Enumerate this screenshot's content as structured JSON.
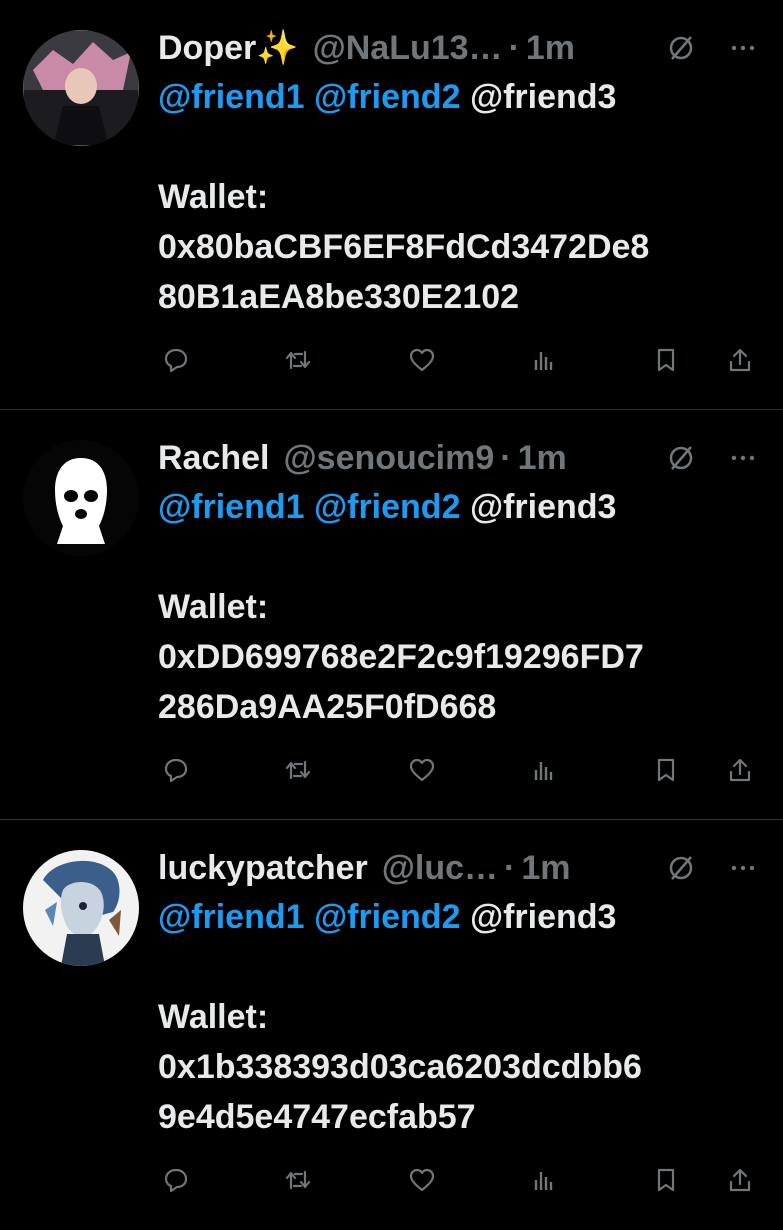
{
  "tweets": [
    {
      "name": "Doper",
      "name_emoji": "✨",
      "handle": "@NaLu13…",
      "separator": "·",
      "time": "1m",
      "mentions": [
        "@friend1",
        "@friend2"
      ],
      "mention_plain": "@friend3",
      "wallet_label": "Wallet:",
      "wallet_line1": "0x80baCBF6EF8FdCd3472De8",
      "wallet_line2": "80B1aEA8be330E2102",
      "avatar_icon": "anime-character-avatar"
    },
    {
      "name": "Rachel",
      "name_emoji": "",
      "handle": "@senoucim9",
      "separator": "·",
      "time": "1m",
      "mentions": [
        "@friend1",
        "@friend2"
      ],
      "mention_plain": "@friend3",
      "wallet_label": "Wallet:",
      "wallet_line1": "0xDD699768e2F2c9f19296FD7",
      "wallet_line2": "286Da9AA25F0fD668",
      "avatar_icon": "ski-mask-avatar"
    },
    {
      "name": "luckypatcher",
      "name_emoji": "",
      "handle": "@luc…",
      "separator": "·",
      "time": "1m",
      "mentions": [
        "@friend1",
        "@friend2"
      ],
      "mention_plain": "@friend3",
      "wallet_label": "Wallet:",
      "wallet_line1": "0x1b338393d03ca6203dcdbb6",
      "wallet_line2": "9e4d5e4747ecfab57",
      "avatar_icon": "cyborg-art-avatar"
    }
  ],
  "colors": {
    "background": "#000000",
    "text": "#e7e9ea",
    "muted": "#71767b",
    "mention": "#1d9bf0",
    "divider": "#2f3336"
  },
  "icons": [
    "reply-icon",
    "retweet-icon",
    "like-icon",
    "views-icon",
    "bookmark-icon",
    "share-icon",
    "grok-icon",
    "more-icon"
  ]
}
